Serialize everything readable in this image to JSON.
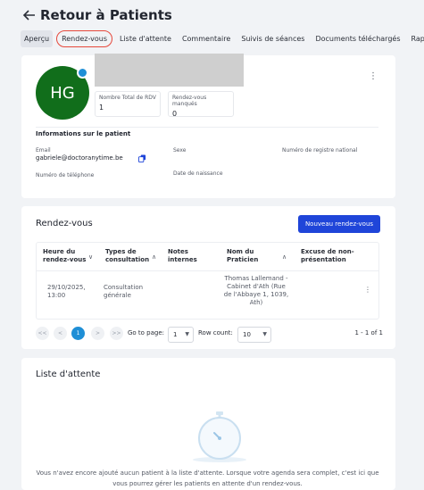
{
  "header": {
    "title": "Retour à Patients"
  },
  "tabs": [
    "Aperçu",
    "Rendez-vous",
    "Liste d'attente",
    "Commentaire",
    "Suivis de séances",
    "Documents téléchargés",
    "Rappels"
  ],
  "patient": {
    "initials": "HG",
    "stats": {
      "total_label": "Nombre Total de RDV",
      "total_value": "1",
      "missed_label": "Rendez-vous manqués",
      "missed_value": "0"
    },
    "info_title": "Informations sur le patient",
    "fields": {
      "email_label": "Email",
      "email_value": "gabriele@doctoranytime.be",
      "sexe_label": "Sexe",
      "registre_label": "Numéro de registre national",
      "phone_label": "Numéro de téléphone",
      "birth_label": "Date de naissance"
    }
  },
  "appointments": {
    "title": "Rendez-vous",
    "new_button": "Nouveau rendez-vous",
    "columns": [
      "Heure du rendez-vous",
      "Types de consultation",
      "Notes internes",
      "Nom du Praticien",
      "Excuse de non-présentation"
    ],
    "rows": [
      {
        "time": "29/10/2025, 13:00",
        "type": "Consultation générale",
        "notes": "",
        "practitioner": "Thomas Lallemand - Cabinet d'Ath (Rue de l'Abbaye 1, 1039, Ath)",
        "excuse": ""
      }
    ],
    "pager": {
      "first": "<<",
      "prev": "<",
      "current": "1",
      "next": ">",
      "last": ">>",
      "go_to_label": "Go to page:",
      "page_value": "1",
      "row_count_label": "Row count:",
      "row_count_value": "10",
      "range": "1 - 1 of 1"
    }
  },
  "waitlist": {
    "title": "Liste d'attente",
    "empty_message": "Vous n'avez encore ajouté aucun patient à la liste d'attente. Lorsque votre agenda sera complet, c'est ici que vous pourrez gérer les patients en attente d'un rendez-vous."
  },
  "colors": {
    "primary": "#1f45d9",
    "avatar": "#116e1b",
    "active_outline": "#e6483b",
    "page_current": "#1f8fd6"
  },
  "icons": [
    "back-arrow-icon",
    "copy-icon",
    "more-vertical-icon",
    "chevron-down-icon",
    "chevron-up-icon",
    "stopwatch-illustration"
  ]
}
